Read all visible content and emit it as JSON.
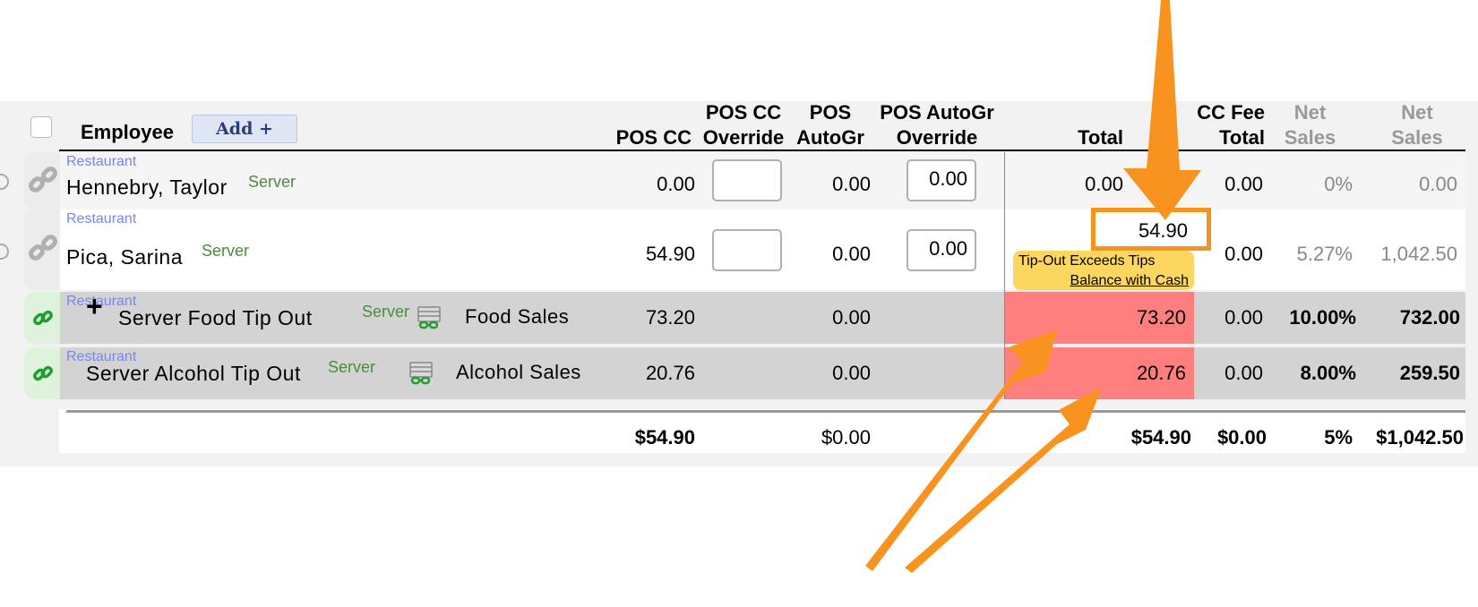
{
  "header": {
    "add_button": "Add +",
    "columns": {
      "employee": "Employee",
      "pos_cc": "POS CC",
      "pos_cc_override": [
        "POS CC",
        "Override"
      ],
      "pos_autogr": [
        "POS",
        "AutoGr"
      ],
      "pos_autogr_override": [
        "POS AutoGr",
        "Override"
      ],
      "total": "Total",
      "cc_fee_total": [
        "CC Fee",
        "Total"
      ],
      "net_sales_pct": [
        "Net",
        "Sales"
      ],
      "net_sales": [
        "Net",
        "Sales"
      ]
    }
  },
  "rows": [
    {
      "location": "Restaurant",
      "name": "Hennebry, Taylor",
      "role": "Server",
      "pos_cc": "0.00",
      "pos_cc_override": "",
      "pos_autogr": "0.00",
      "pos_autogr_override": "0.00",
      "total": "0.00",
      "cc_fee_total": "0.00",
      "net_sales_pct": "0%",
      "net_sales": "0.00"
    },
    {
      "location": "Restaurant",
      "name": "Pica, Sarina",
      "role": "Server",
      "pos_cc": "54.90",
      "pos_cc_override": "",
      "pos_autogr": "0.00",
      "pos_autogr_override": "0.00",
      "total": "54.90",
      "warning_line1": "Tip-Out Exceeds Tips",
      "warning_line2": "Balance with Cash",
      "cc_fee_total": "0.00",
      "net_sales_pct": "5.27%",
      "net_sales": "1,042.50"
    },
    {
      "location": "Restaurant",
      "name": "Server Food Tip Out",
      "role": "Server",
      "sales_category": "Food Sales",
      "pos_cc": "73.20",
      "pos_autogr": "0.00",
      "total": "73.20",
      "cc_fee_total": "0.00",
      "net_sales_pct": "10.00%",
      "net_sales": "732.00"
    },
    {
      "location": "Restaurant",
      "name": "Server Alcohol Tip Out",
      "role": "Server",
      "sales_category": "Alcohol Sales",
      "pos_cc": "20.76",
      "pos_autogr": "0.00",
      "total": "20.76",
      "cc_fee_total": "0.00",
      "net_sales_pct": "8.00%",
      "net_sales": "259.50"
    }
  ],
  "totals": {
    "pos_cc": "$54.90",
    "pos_autogr": "$0.00",
    "total": "$54.90",
    "cc_fee_total": "$0.00",
    "net_sales_pct": "5%",
    "net_sales": "$1,042.50"
  },
  "colors": {
    "annotation_orange": "#f7931e",
    "negative_cell_red": "#ff7f7f",
    "warning_yellow": "#fcd75f",
    "tipout_row_grey": "#d3d3d3",
    "link_green_bg": "#dff2dc",
    "link_icon_green": "#1f9e2e",
    "location_blue": "#7b85e8",
    "role_green": "#4d8a3e"
  },
  "icons": [
    "select-all-checkbox",
    "unlink-chain-icon",
    "link-chain-icon",
    "money-stack-icon",
    "plus-icon"
  ]
}
